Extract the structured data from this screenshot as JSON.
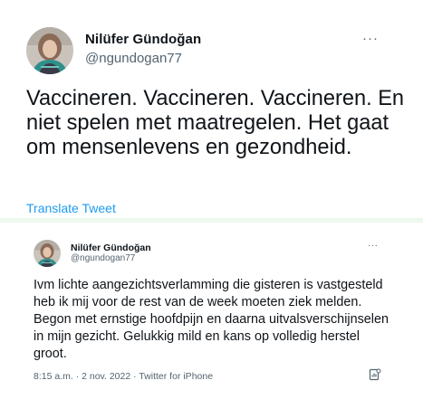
{
  "top_tweet": {
    "name": "Nilüfer Gündoğan",
    "handle": "@ngundogan77",
    "more": "···",
    "text": "Vaccineren. Vaccineren. Vaccineren. En niet spelen met maatregelen. Het gaat om mensenlevens en gezondheid.",
    "translate_label": "Translate Tweet"
  },
  "quoted_tweet": {
    "name": "Nilüfer Gündoğan",
    "handle": "@ngundogan77",
    "more": "···",
    "text": "Ivm lichte aangezichtsverlamming die gisteren is vastgesteld heb ik mij voor de rest van de week moeten ziek melden. Begon met ernstige hoofdpijn en daarna uitvalsverschijnselen in mijn gezicht. Gelukkig mild en kans op volledig herstel groot.",
    "footer": "8:15 a.m. · 2 nov. 2022 · Twitter for iPhone",
    "footer_icon": "tweet-stats-icon"
  },
  "colors": {
    "link": "#1d9bf0",
    "secondary_text": "#536471",
    "divider": "#eef8ee"
  }
}
